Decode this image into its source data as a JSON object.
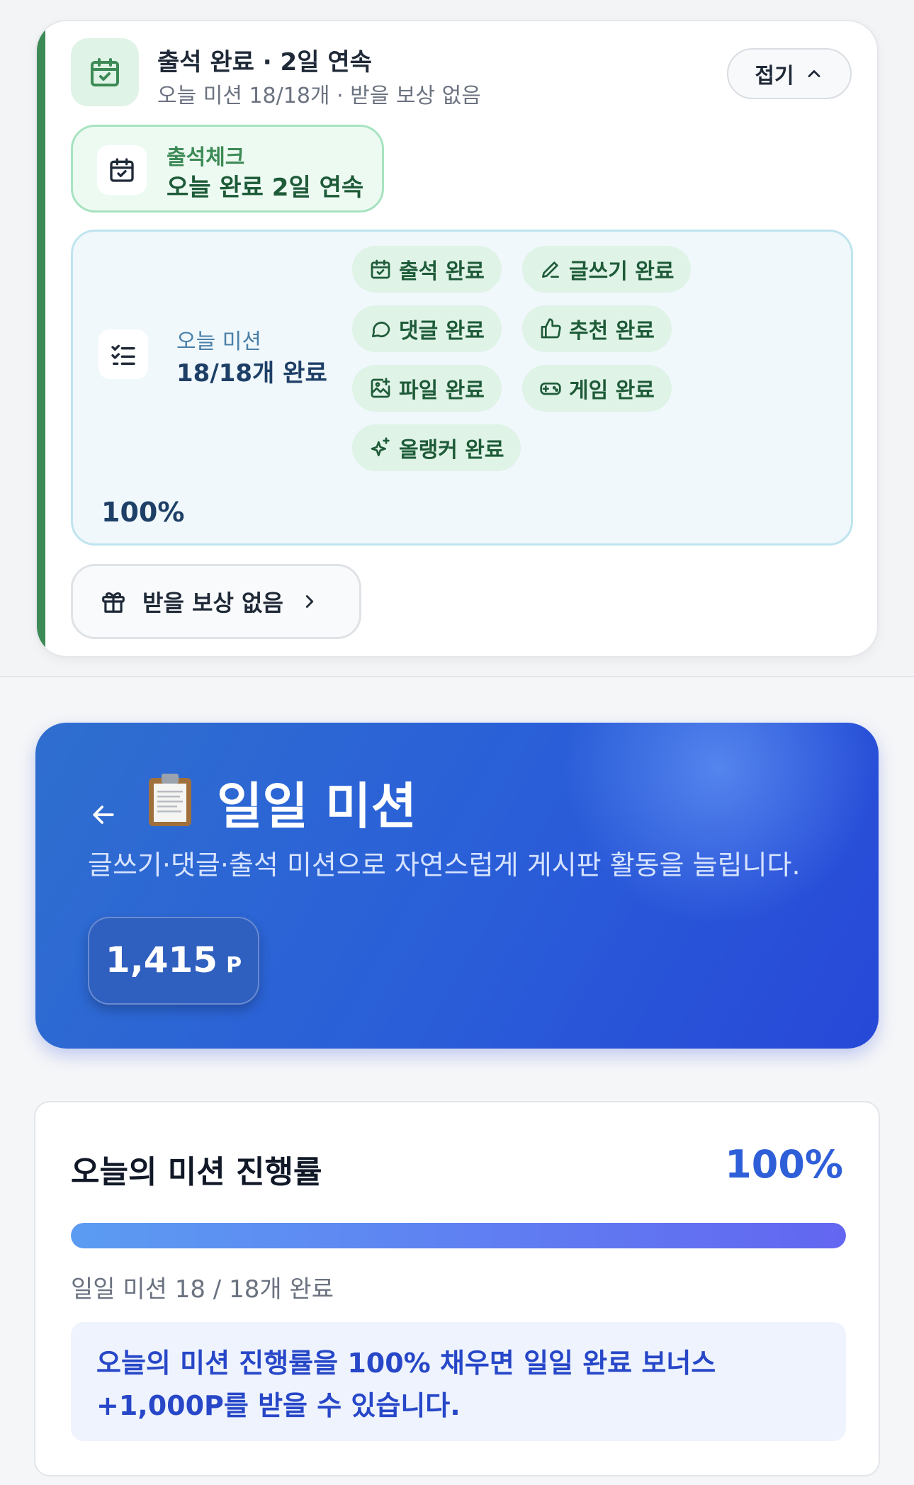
{
  "attendance": {
    "title": "출석 완료 · 2일 연속",
    "subtitle": "오늘 미션 18/18개 · 받을 보상 없음",
    "fold_label": "접기",
    "check": {
      "label": "출석체크",
      "value": "오늘 완료 2일 연속"
    },
    "missions": {
      "label": "오늘 미션",
      "value": "18/18개 완료",
      "percent": "100%",
      "chips": [
        {
          "icon": "calendar-check-icon",
          "label": "출석 완료"
        },
        {
          "icon": "pencil-icon",
          "label": "글쓰기 완료"
        },
        {
          "icon": "speech-bubble-icon",
          "label": "댓글 완료"
        },
        {
          "icon": "thumbs-up-icon",
          "label": "추천 완료"
        },
        {
          "icon": "image-upload-icon",
          "label": "파일 완료"
        },
        {
          "icon": "gamepad-icon",
          "label": "게임 완료"
        },
        {
          "icon": "sparkle-icon",
          "label": "올랭커 완료"
        }
      ]
    },
    "reward_label": "받을 보상 없음"
  },
  "hero": {
    "title": "일일 미션",
    "description": "글쓰기·댓글·출석 미션으로 자연스럽게 게시판 활동을 늘립니다.",
    "points": "1,415",
    "points_unit": "P"
  },
  "progress": {
    "title": "오늘의 미션 진행률",
    "percent_label": "100%",
    "percent_value": 100,
    "count_text": "일일 미션 18 / 18개 완료",
    "note_line1": "오늘의 미션 진행률을 100% 채우면 일일 완료 보너스",
    "note_line2": "+1,000P를 받을 수 있습니다."
  },
  "colors": {
    "green_accent": "#3c8a55",
    "blue_accent": "#2f5fd8",
    "hero_gradient_start": "#2f6fcf",
    "hero_gradient_end": "#2748d8"
  }
}
